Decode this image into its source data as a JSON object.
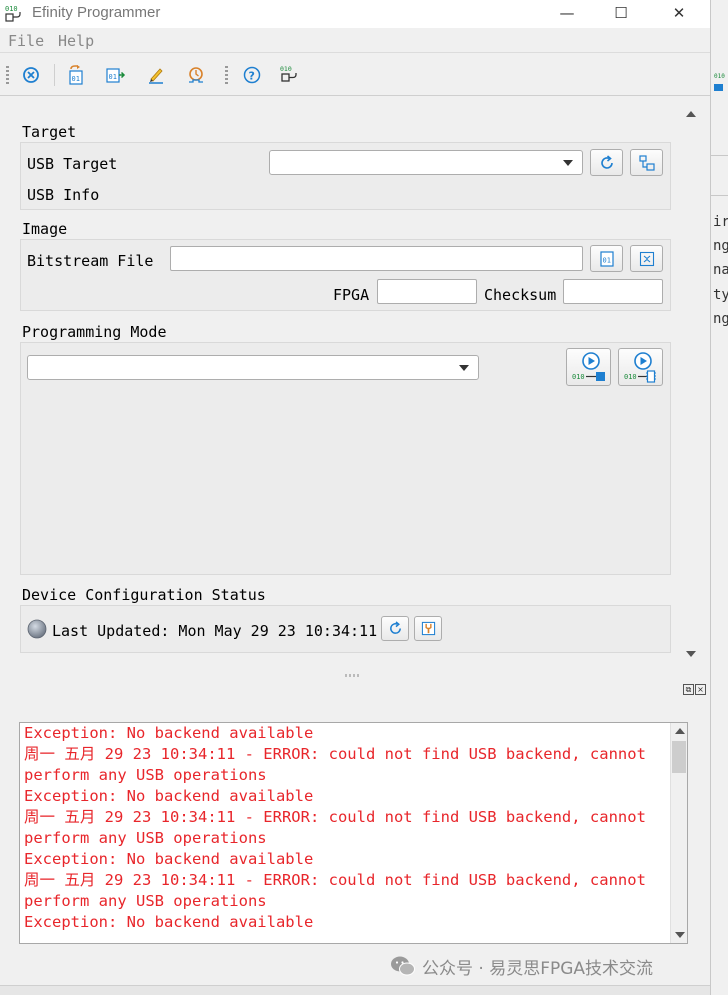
{
  "window": {
    "title": "Efinity Programmer",
    "controls": {
      "minimize": "—",
      "maximize": "☐",
      "close": "✕"
    }
  },
  "menu": {
    "file": "File",
    "help": "Help"
  },
  "toolbar": {
    "buttons": [
      "stop-icon",
      "open-bitstream-icon",
      "program-icon",
      "edit-icon",
      "timer-icon",
      "help-icon",
      "connect-icon"
    ]
  },
  "target": {
    "section_title": "Target",
    "usb_target_label": "USB Target",
    "usb_target_value": "",
    "usb_info_label": "USB Info"
  },
  "image": {
    "section_title": "Image",
    "bitstream_label": "Bitstream File",
    "bitstream_value": "",
    "fpga_label": "FPGA",
    "fpga_value": "",
    "checksum_label": "Checksum",
    "checksum_value": ""
  },
  "programming_mode": {
    "section_title": "Programming Mode",
    "mode_value": ""
  },
  "device_status": {
    "section_title": "Device Configuration Status",
    "last_updated": "Last Updated: Mon May 29 23 10:34:11"
  },
  "log": {
    "lines": [
      "Exception: No backend available",
      "周一 五月 29 23 10:34:11 - ERROR: could not find USB backend, cannot",
      "perform any USB operations",
      "Exception: No backend available",
      "周一 五月 29 23 10:34:11 - ERROR: could not find USB backend, cannot",
      "perform any USB operations",
      "Exception: No backend available",
      "周一 五月 29 23 10:34:11 - ERROR: could not find USB backend, cannot",
      "perform any USB operations",
      "Exception: No backend available"
    ]
  },
  "background_window": {
    "fragments": [
      "ir",
      "ng",
      "na",
      "ty",
      "ng"
    ]
  },
  "watermark": {
    "text": "公众号 · 易灵思FPGA技术交流"
  },
  "colors": {
    "error_text": "#e8262b",
    "accent": "#1e7fd0"
  }
}
